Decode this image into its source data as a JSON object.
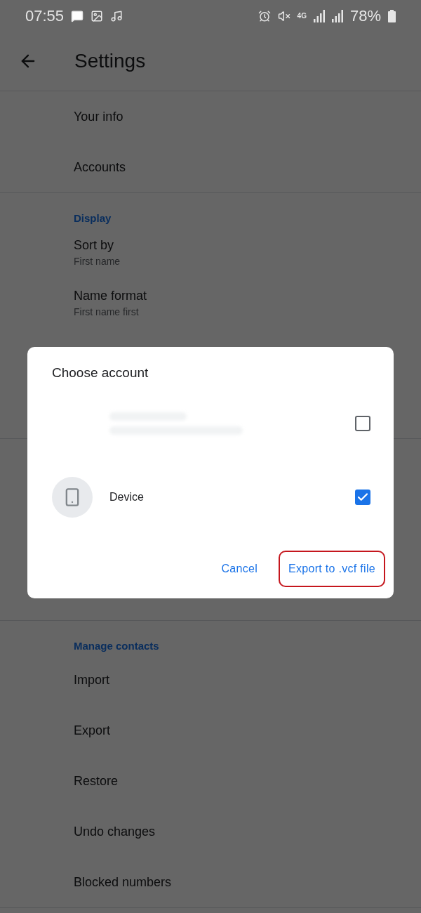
{
  "status_bar": {
    "time": "07:55",
    "network": "4G",
    "battery": "78%"
  },
  "app_bar": {
    "title": "Settings"
  },
  "sections": [
    {
      "items": [
        {
          "title": "Your info"
        },
        {
          "title": "Accounts"
        }
      ]
    },
    {
      "header": "Display",
      "items": [
        {
          "title": "Sort by",
          "subtitle": "First name"
        },
        {
          "title": "Name format",
          "subtitle": "First name first"
        }
      ]
    },
    {
      "header": "Manage contacts",
      "items": [
        {
          "title": "Import"
        },
        {
          "title": "Export"
        },
        {
          "title": "Restore"
        },
        {
          "title": "Undo changes"
        },
        {
          "title": "Blocked numbers"
        }
      ]
    }
  ],
  "dialog": {
    "title": "Choose account",
    "accounts": [
      {
        "kind": "redacted",
        "checked": false
      },
      {
        "kind": "device",
        "label": "Device",
        "checked": true
      }
    ],
    "buttons": [
      {
        "label": "Cancel",
        "highlighted": false
      },
      {
        "label": "Export to .vcf file",
        "highlighted": true
      }
    ]
  }
}
